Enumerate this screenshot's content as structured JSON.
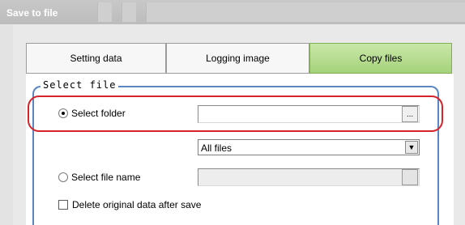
{
  "window": {
    "title": "Save to file"
  },
  "tabs": [
    {
      "label": "Setting data",
      "active": false
    },
    {
      "label": "Logging image",
      "active": false
    },
    {
      "label": "Copy files",
      "active": true
    }
  ],
  "group": {
    "label": "Select file"
  },
  "select_folder": {
    "label": "Select folder",
    "checked": true,
    "value": "",
    "browse_label": "..."
  },
  "file_filter": {
    "selected": "All files"
  },
  "select_file_name": {
    "label": "Select file name",
    "checked": false,
    "value": "",
    "browse_label": ""
  },
  "delete_original": {
    "label": "Delete original data after save",
    "checked": false
  },
  "colors": {
    "active_tab": "#a6d27a",
    "group_border": "#5b86c4",
    "highlight": "#d6232a"
  }
}
